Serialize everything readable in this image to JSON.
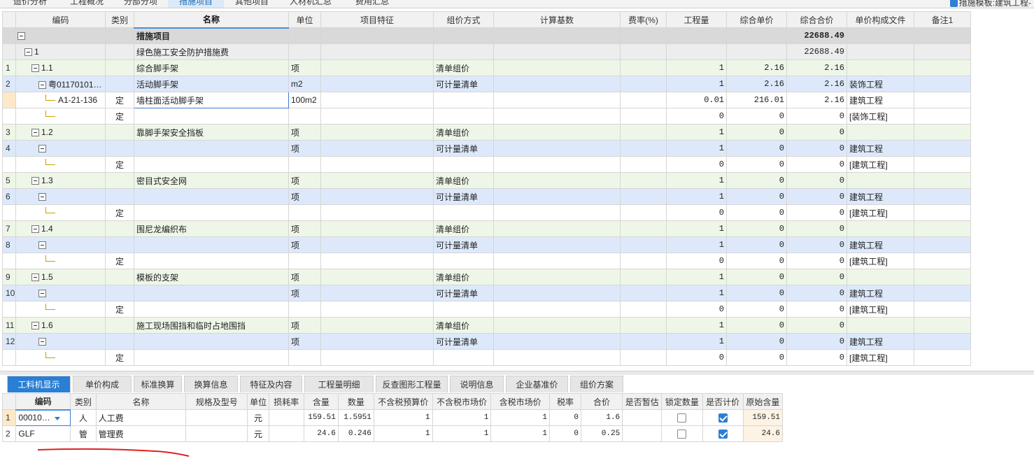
{
  "top_tabs": [
    "造价分析",
    "工程概况",
    "分部分项",
    "措施项目",
    "其他项目",
    "人材机汇总",
    "费用汇总"
  ],
  "top_right_label": "措施模板:建筑工程-",
  "main_columns": [
    "",
    "编码",
    "类别",
    "名称",
    "单位",
    "项目特征",
    "组价方式",
    "计算基数",
    "费率(%)",
    "工程量",
    "综合单价",
    "综合合价",
    "单价构成文件",
    "备注1"
  ],
  "main_rows": [
    {
      "rn": "",
      "code": "",
      "type": "",
      "name": "措施项目",
      "unit": "",
      "feature": "",
      "method": "",
      "base": "",
      "rate": "",
      "qty": "",
      "price": "",
      "total": "22688.49",
      "file": "",
      "note": ""
    },
    {
      "rn": "",
      "code": "1",
      "type": "",
      "name": "绿色施工安全防护措施费",
      "unit": "",
      "feature": "",
      "method": "",
      "base": "",
      "rate": "",
      "qty": "",
      "price": "",
      "total": "22688.49",
      "file": "",
      "note": ""
    },
    {
      "rn": "1",
      "code": "1.1",
      "type": "",
      "name": "综合脚手架",
      "unit": "项",
      "feature": "",
      "method": "清单组价",
      "base": "",
      "rate": "",
      "qty": "1",
      "price": "2.16",
      "total": "2.16",
      "file": "",
      "note": ""
    },
    {
      "rn": "2",
      "code": "粤01170101…",
      "type": "",
      "name": "活动脚手架",
      "unit": "m2",
      "feature": "",
      "method": "可计量清单",
      "base": "",
      "rate": "",
      "qty": "1",
      "price": "2.16",
      "total": "2.16",
      "file": "装饰工程",
      "note": ""
    },
    {
      "rn": "",
      "code": "A1-21-136",
      "type": "定",
      "name": "墙柱面活动脚手架",
      "unit": "100m2",
      "feature": "",
      "method": "",
      "base": "",
      "rate": "",
      "qty": "0.01",
      "price": "216.01",
      "total": "2.16",
      "file": "建筑工程",
      "note": ""
    },
    {
      "rn": "",
      "code": "",
      "type": "定",
      "name": "",
      "unit": "",
      "feature": "",
      "method": "",
      "base": "",
      "rate": "",
      "qty": "0",
      "price": "0",
      "total": "0",
      "file": "[装饰工程]",
      "note": ""
    },
    {
      "rn": "3",
      "code": "1.2",
      "type": "",
      "name": "靠脚手架安全挡板",
      "unit": "项",
      "feature": "",
      "method": "清单组价",
      "base": "",
      "rate": "",
      "qty": "1",
      "price": "0",
      "total": "0",
      "file": "",
      "note": ""
    },
    {
      "rn": "4",
      "code": "",
      "type": "",
      "name": "",
      "unit": "项",
      "feature": "",
      "method": "可计量清单",
      "base": "",
      "rate": "",
      "qty": "1",
      "price": "0",
      "total": "0",
      "file": "建筑工程",
      "note": ""
    },
    {
      "rn": "",
      "code": "",
      "type": "定",
      "name": "",
      "unit": "",
      "feature": "",
      "method": "",
      "base": "",
      "rate": "",
      "qty": "0",
      "price": "0",
      "total": "0",
      "file": "[建筑工程]",
      "note": ""
    },
    {
      "rn": "5",
      "code": "1.3",
      "type": "",
      "name": "密目式安全网",
      "unit": "项",
      "feature": "",
      "method": "清单组价",
      "base": "",
      "rate": "",
      "qty": "1",
      "price": "0",
      "total": "0",
      "file": "",
      "note": ""
    },
    {
      "rn": "6",
      "code": "",
      "type": "",
      "name": "",
      "unit": "项",
      "feature": "",
      "method": "可计量清单",
      "base": "",
      "rate": "",
      "qty": "1",
      "price": "0",
      "total": "0",
      "file": "建筑工程",
      "note": ""
    },
    {
      "rn": "",
      "code": "",
      "type": "定",
      "name": "",
      "unit": "",
      "feature": "",
      "method": "",
      "base": "",
      "rate": "",
      "qty": "0",
      "price": "0",
      "total": "0",
      "file": "[建筑工程]",
      "note": ""
    },
    {
      "rn": "7",
      "code": "1.4",
      "type": "",
      "name": "围尼龙编织布",
      "unit": "项",
      "feature": "",
      "method": "清单组价",
      "base": "",
      "rate": "",
      "qty": "1",
      "price": "0",
      "total": "0",
      "file": "",
      "note": ""
    },
    {
      "rn": "8",
      "code": "",
      "type": "",
      "name": "",
      "unit": "项",
      "feature": "",
      "method": "可计量清单",
      "base": "",
      "rate": "",
      "qty": "1",
      "price": "0",
      "total": "0",
      "file": "建筑工程",
      "note": ""
    },
    {
      "rn": "",
      "code": "",
      "type": "定",
      "name": "",
      "unit": "",
      "feature": "",
      "method": "",
      "base": "",
      "rate": "",
      "qty": "0",
      "price": "0",
      "total": "0",
      "file": "[建筑工程]",
      "note": ""
    },
    {
      "rn": "9",
      "code": "1.5",
      "type": "",
      "name": "模板的支架",
      "unit": "项",
      "feature": "",
      "method": "清单组价",
      "base": "",
      "rate": "",
      "qty": "1",
      "price": "0",
      "total": "0",
      "file": "",
      "note": ""
    },
    {
      "rn": "10",
      "code": "",
      "type": "",
      "name": "",
      "unit": "项",
      "feature": "",
      "method": "可计量清单",
      "base": "",
      "rate": "",
      "qty": "1",
      "price": "0",
      "total": "0",
      "file": "建筑工程",
      "note": ""
    },
    {
      "rn": "",
      "code": "",
      "type": "定",
      "name": "",
      "unit": "",
      "feature": "",
      "method": "",
      "base": "",
      "rate": "",
      "qty": "0",
      "price": "0",
      "total": "0",
      "file": "[建筑工程]",
      "note": ""
    },
    {
      "rn": "11",
      "code": "1.6",
      "type": "",
      "name": "施工现场围挡和临时占地围挡",
      "unit": "项",
      "feature": "",
      "method": "清单组价",
      "base": "",
      "rate": "",
      "qty": "1",
      "price": "0",
      "total": "0",
      "file": "",
      "note": ""
    },
    {
      "rn": "12",
      "code": "",
      "type": "",
      "name": "",
      "unit": "项",
      "feature": "",
      "method": "可计量清单",
      "base": "",
      "rate": "",
      "qty": "1",
      "price": "0",
      "total": "0",
      "file": "建筑工程",
      "note": ""
    },
    {
      "rn": "",
      "code": "",
      "type": "定",
      "name": "",
      "unit": "",
      "feature": "",
      "method": "",
      "base": "",
      "rate": "",
      "qty": "0",
      "price": "0",
      "total": "0",
      "file": "[建筑工程]",
      "note": ""
    }
  ],
  "bottom_tabs": [
    "工料机显示",
    "单价构成",
    "标准换算",
    "换算信息",
    "特征及内容",
    "工程量明细",
    "反查图形工程量",
    "说明信息",
    "企业基准价",
    "组价方案"
  ],
  "sub_columns": [
    "",
    "编码",
    "类别",
    "名称",
    "规格及型号",
    "单位",
    "损耗率",
    "含量",
    "数量",
    "不含税预算价",
    "不含税市场价",
    "含税市场价",
    "税率",
    "合价",
    "是否暂估",
    "锁定数量",
    "是否计价",
    "原始含量"
  ],
  "sub_rows": [
    {
      "rn": "1",
      "code": "00010…",
      "type": "人",
      "name": "人工费",
      "spec": "",
      "unit": "元",
      "loss": "",
      "content": "159.51",
      "qty": "1.5951",
      "budget": "1",
      "market": "1",
      "taxmarket": "1",
      "taxrate": "0",
      "total": "1.6",
      "est": "",
      "lock": false,
      "priced": true,
      "orig": "159.51"
    },
    {
      "rn": "2",
      "code": "GLF",
      "type": "管",
      "name": "管理费",
      "spec": "",
      "unit": "元",
      "loss": "",
      "content": "24.6",
      "qty": "0.246",
      "budget": "1",
      "market": "1",
      "taxmarket": "1",
      "taxrate": "0",
      "total": "0.25",
      "est": "",
      "lock": false,
      "priced": true,
      "orig": "24.6"
    }
  ]
}
